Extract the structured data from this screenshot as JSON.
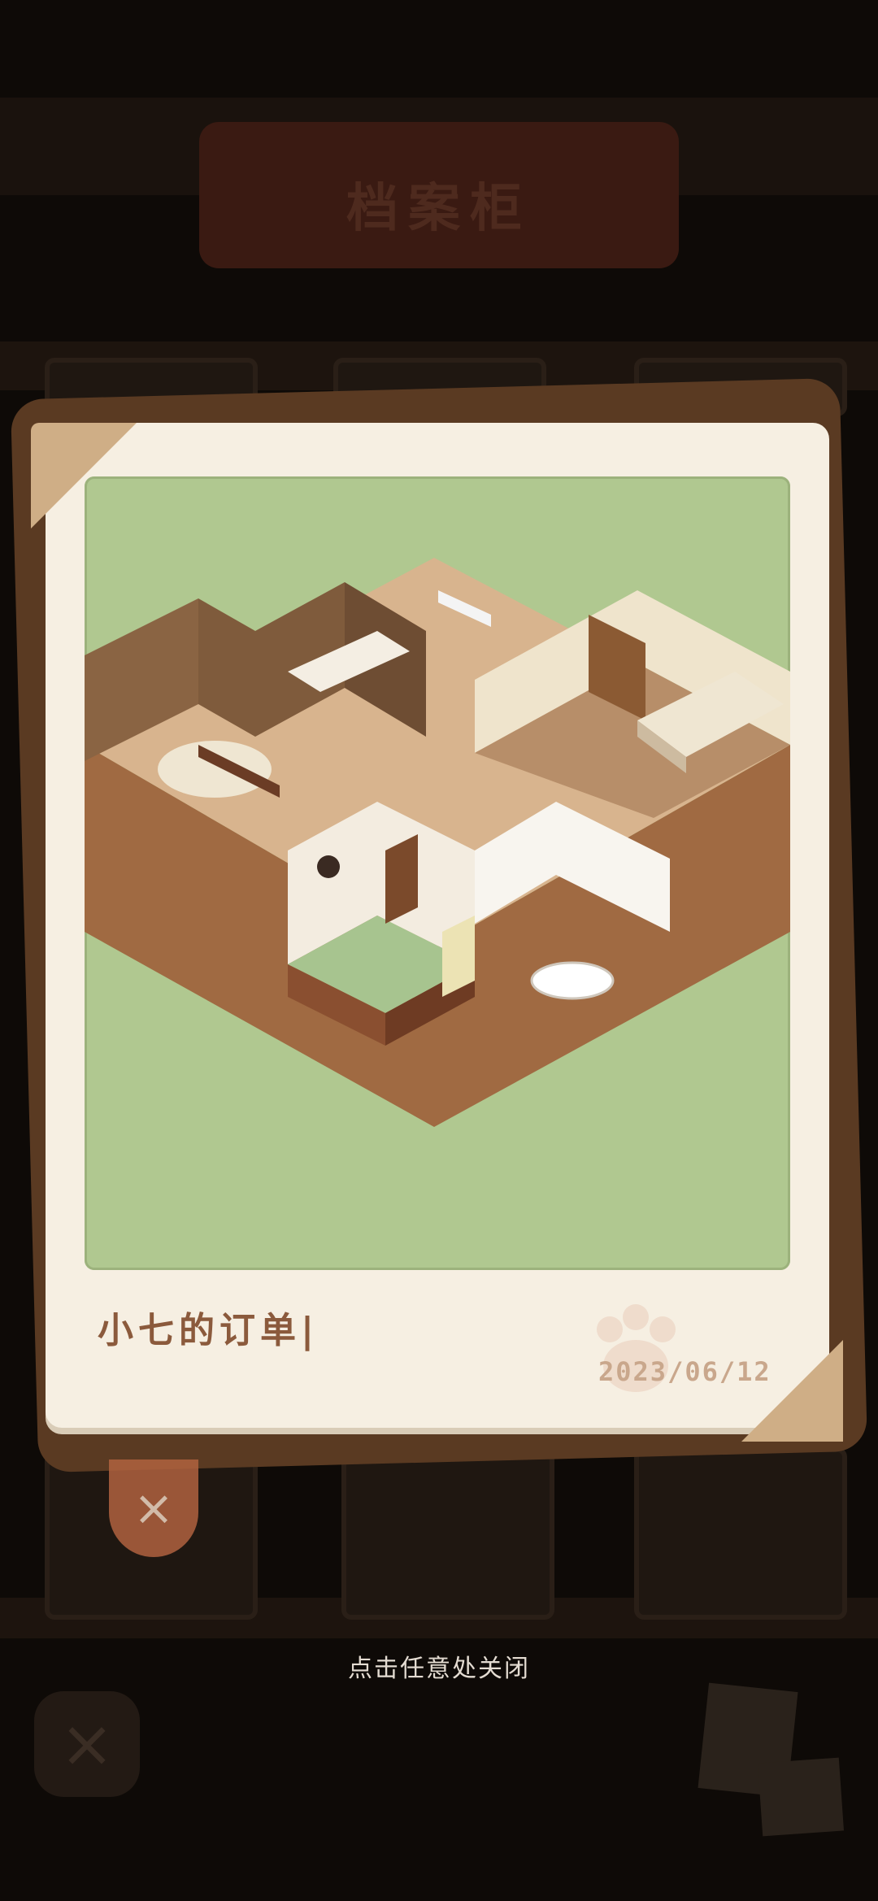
{
  "header": {
    "title": "档案柜"
  },
  "photo": {
    "caption": "小七的订单|",
    "date": "2023/06/12",
    "image_alt": "isometric-house-interior"
  },
  "overlay": {
    "hint": "点击任意处关闭",
    "close_icon": "×"
  },
  "colors": {
    "overlay": "#0e0a07",
    "card": "#f6efe2",
    "picture_bg": "#b0c890",
    "caption": "#8b5a3c",
    "date": "#c9a78c",
    "close": "#b0623f"
  }
}
